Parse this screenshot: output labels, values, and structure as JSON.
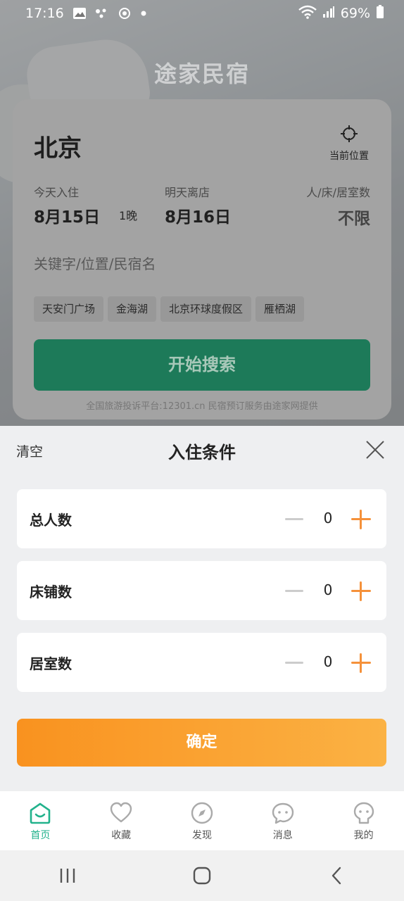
{
  "status_bar": {
    "time": "17:16",
    "battery": "69%"
  },
  "brand": "途家民宿",
  "search_card": {
    "city": "北京",
    "current_location_label": "当前位置",
    "checkin_label": "今天入住",
    "checkin_date": "8月15日",
    "nights": "1晚",
    "checkout_label": "明天离店",
    "checkout_date": "8月16日",
    "guests_label": "人/床/居室数",
    "guests_value": "不限",
    "keyword_placeholder": "关键字/位置/民宿名",
    "chips": [
      "天安门广场",
      "金海湖",
      "北京环球度假区",
      "雁栖湖"
    ],
    "search_button": "开始搜索",
    "footnote": "全国旅游投诉平台:12301.cn 民宿预订服务由途家网提供"
  },
  "sheet": {
    "clear": "清空",
    "title": "入住条件",
    "rows": [
      {
        "name": "总人数",
        "count": "0"
      },
      {
        "name": "床铺数",
        "count": "0"
      },
      {
        "name": "居室数",
        "count": "0"
      }
    ],
    "confirm": "确定"
  },
  "tabbar": {
    "tabs": [
      {
        "label": "首页",
        "icon": "home-icon",
        "active": true
      },
      {
        "label": "收藏",
        "icon": "heart-icon",
        "active": false
      },
      {
        "label": "发现",
        "icon": "compass-icon",
        "active": false
      },
      {
        "label": "消息",
        "icon": "message-icon",
        "active": false
      },
      {
        "label": "我的",
        "icon": "profile-icon",
        "active": false
      }
    ]
  },
  "colors": {
    "accent_green": "#22b28c",
    "accent_orange": "#f5913a"
  }
}
